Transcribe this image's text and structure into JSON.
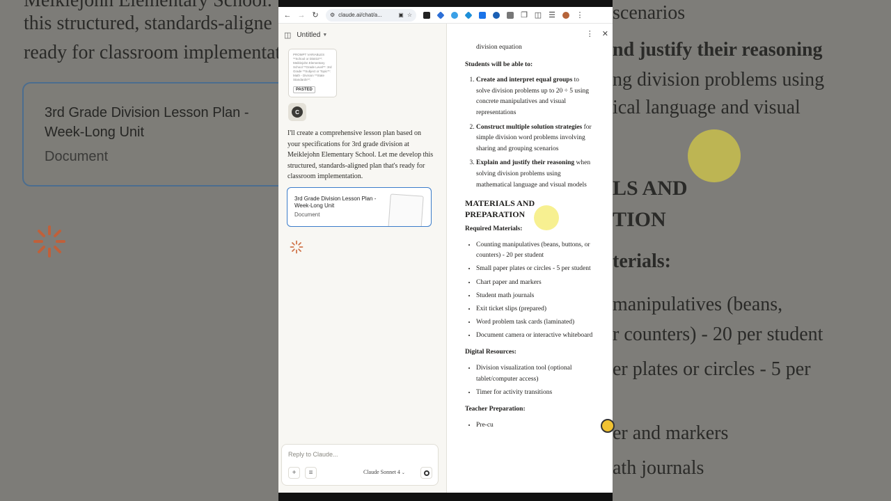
{
  "background": {
    "left_lines": [
      "Meiklejohn Elementary School.",
      "this structured, standards-aligne",
      "ready for classroom implementati"
    ],
    "card_title": "3rd Grade Division Lesson Plan - Week-Long Unit",
    "card_sub": "Document",
    "right_lines": [
      {
        "text": "scenarios"
      },
      {
        "text": "nd justify their reasoning"
      },
      {
        "text": "ng division problems using"
      },
      {
        "text": "ical language and visual"
      },
      {
        "text": "LS AND"
      },
      {
        "text": "TION"
      },
      {
        "text": "terials:"
      },
      {
        "text": "manipulatives (beans,"
      },
      {
        "text": "r counters) - 20 per student"
      },
      {
        "text": "er plates or circles - 5 per"
      },
      {
        "text": "er and markers"
      },
      {
        "text": "ath journals"
      }
    ]
  },
  "browser": {
    "url": "claude.ai/chat/a..."
  },
  "chat": {
    "title": "Untitled",
    "paste_preview": "PROMPT VARIABLES **School or District**: Meiklejohn Elementary School **Grade Level**: 3rd Grade **Subject or Topic**: Math - Division **State Standards**:",
    "paste_tag": "PASTED",
    "avatar_letter": "C",
    "message": "I'll create a comprehensive lesson plan based on your specifications for 3rd grade division at Meiklejohn Elementary School. Let me develop this structured, standards-aligned plan that's ready for classroom implementation.",
    "doc_card_title": "3rd Grade Division Lesson Plan - Week-Long Unit",
    "doc_card_sub": "Document",
    "reply_placeholder": "Reply to Claude...",
    "model": "Claude Sonnet 4"
  },
  "doc": {
    "top_line": "division equation",
    "objectives_heading": "Students will be able to:",
    "objectives": [
      {
        "bold": "Create and interpret equal groups",
        "rest": " to solve division problems up to 20 ÷ 5 using concrete manipulatives and visual representations"
      },
      {
        "bold": "Construct multiple solution strategies",
        "rest": " for simple division word problems involving sharing and grouping scenarios"
      },
      {
        "bold": "Explain and justify their reasoning",
        "rest": " when solving division problems using mathematical language and visual models"
      }
    ],
    "materials_heading": "MATERIALS AND PREPARATION",
    "required_heading": "Required Materials:",
    "required": [
      "Counting manipulatives (beans, buttons, or counters) - 20 per student",
      "Small paper plates or circles - 5 per student",
      "Chart paper and markers",
      "Student math journals",
      "Exit ticket slips (prepared)",
      "Word problem task cards (laminated)",
      "Document camera or interactive whiteboard"
    ],
    "digital_heading": "Digital Resources:",
    "digital": [
      "Division visualization tool (optional tablet/computer access)",
      "Timer for activity transitions"
    ],
    "teacher_heading": "Teacher Preparation:",
    "teacher": [
      "Pre-cu"
    ]
  }
}
